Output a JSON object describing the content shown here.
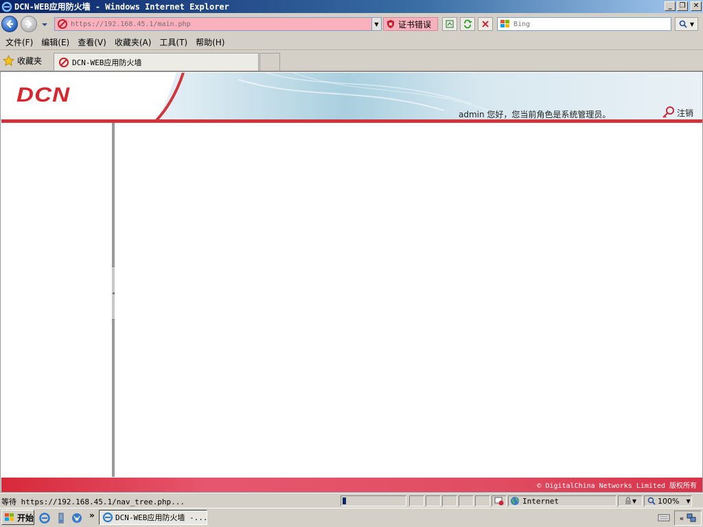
{
  "window": {
    "title": "DCN-WEB应用防火墙 - Windows Internet Explorer",
    "minimize": "_",
    "restore": "❐",
    "close": "✕"
  },
  "address": {
    "url": "https://192.168.45.1/main.php",
    "cert_error": "证书错误",
    "search_placeholder": "Bing"
  },
  "menu": [
    {
      "label": "文件(F)"
    },
    {
      "label": "编辑(E)"
    },
    {
      "label": "查看(V)"
    },
    {
      "label": "收藏夹(A)"
    },
    {
      "label": "工具(T)"
    },
    {
      "label": "帮助(H)"
    }
  ],
  "favorites": {
    "label": "收藏夹",
    "tab_title": "DCN-WEB应用防火墙"
  },
  "page": {
    "logo": "DCN",
    "greeting": "admin 您好，您当前角色是系统管理员。",
    "logout": "注销",
    "footer": "© DigitalChina Networks Limited 版权所有"
  },
  "status": {
    "text": "等待 https://192.168.45.1/nav_tree.php...",
    "progress": 0.05,
    "zone": "Internet",
    "zoom": "100%"
  },
  "taskbar": {
    "start": "开始",
    "task_title": "DCN-WEB应用防火墙 -...",
    "more": "»",
    "tray_arrows": "«"
  },
  "colors": {
    "brand_red": "#d9252d",
    "error_pink": "#f9b2bd"
  }
}
